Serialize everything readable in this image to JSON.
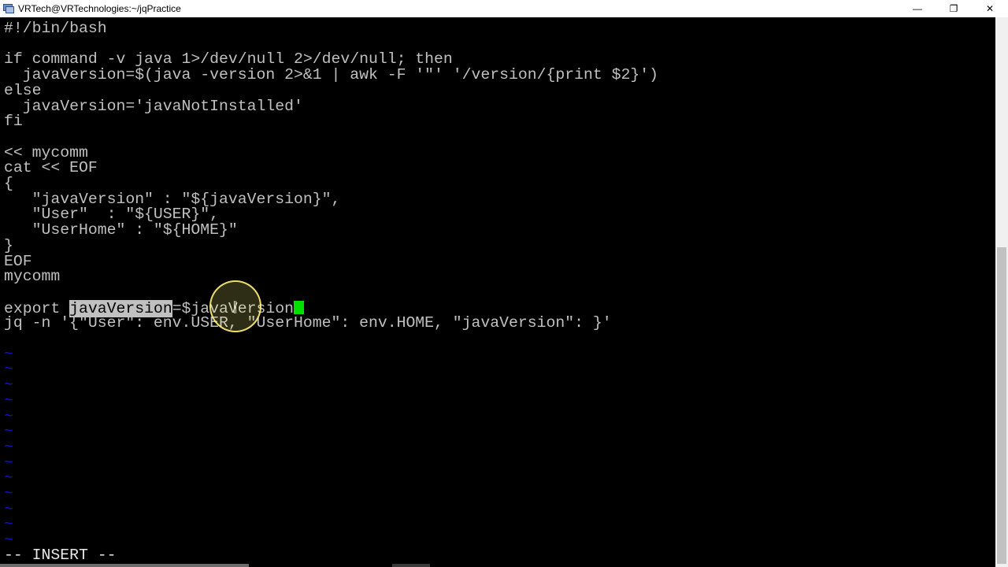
{
  "window": {
    "title": "VRTech@VRTechnologies:~/jqPractice",
    "minimize_glyph": "—",
    "restore_glyph": "❐",
    "close_glyph": "✕"
  },
  "editor": {
    "lines": [
      "#!/bin/bash",
      "",
      "if command -v java 1>/dev/null 2>/dev/null; then",
      "  javaVersion=$(java -version 2>&1 | awk -F '\"' '/version/{print $2}')",
      "else",
      "  javaVersion='javaNotInstalled'",
      "fi",
      "",
      "<< mycomm",
      "cat << EOF",
      "{",
      "   \"javaVersion\" : \"${javaVersion}\",",
      "   \"User\"  : \"${USER}\",",
      "   \"UserHome\" : \"${HOME}\"",
      "}",
      "EOF",
      "mycomm",
      ""
    ],
    "export_line": {
      "prefix": "export ",
      "selected": "javaVersion",
      "suffix": "=$javaVersion"
    },
    "jq_line": "jq -n '{\"User\": env.USER, \"UserHome\": env.HOME, \"javaVersion\": }'",
    "tilde_glyph": "~",
    "tilde_count": 13,
    "mode_label": "-- INSERT --"
  },
  "colors": {
    "text": "#c0c0c0",
    "tilde": "#1010e0",
    "cursor": "#00e000",
    "selection_bg": "#c0c0c0"
  }
}
